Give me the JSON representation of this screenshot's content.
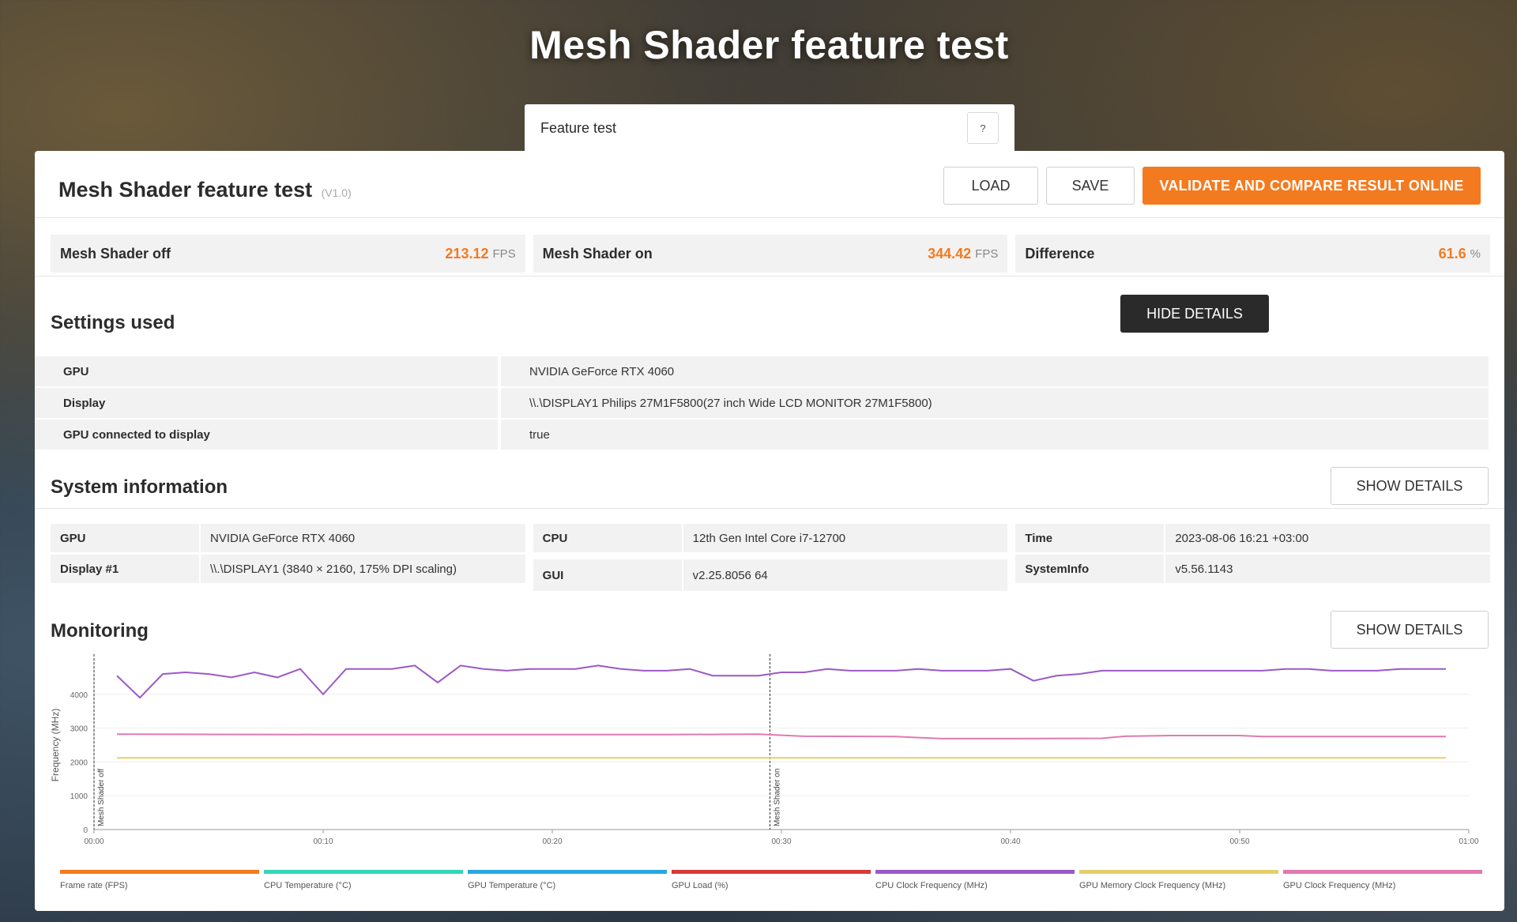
{
  "hero_title": "Mesh Shader feature test",
  "tab_selector": {
    "label": "Feature test",
    "help": "?"
  },
  "panel": {
    "title": "Mesh Shader feature test",
    "version": "(V1.0)",
    "load_label": "LOAD",
    "save_label": "SAVE",
    "validate_label": "VALIDATE AND COMPARE RESULT ONLINE"
  },
  "scores": [
    {
      "label": "Mesh Shader off",
      "value": "213.12",
      "unit": "FPS"
    },
    {
      "label": "Mesh Shader on",
      "value": "344.42",
      "unit": "FPS"
    },
    {
      "label": "Difference",
      "value": "61.6",
      "unit": "%"
    }
  ],
  "settings": {
    "title": "Settings used",
    "button": "HIDE DETAILS",
    "rows": [
      {
        "key": "GPU",
        "value": "NVIDIA GeForce RTX 4060"
      },
      {
        "key": "Display",
        "value": "\\\\.\\DISPLAY1 Philips 27M1F5800(27 inch Wide LCD MONITOR 27M1F5800)"
      },
      {
        "key": "GPU connected to display",
        "value": "true"
      }
    ]
  },
  "system": {
    "title": "System information",
    "button": "SHOW DETAILS",
    "columns": [
      [
        {
          "key": "GPU",
          "value": "NVIDIA GeForce RTX 4060"
        },
        {
          "key": "Display #1",
          "value": "\\\\.\\DISPLAY1 (3840 × 2160, 175% DPI scaling)"
        }
      ],
      [
        {
          "key": "CPU",
          "value": "12th Gen Intel Core i7-12700"
        },
        {
          "key": "GUI",
          "value": "v2.25.8056 64"
        }
      ],
      [
        {
          "key": "Time",
          "value": "2023-08-06 16:21 +03:00"
        },
        {
          "key": "SystemInfo",
          "value": "v5.56.1143"
        }
      ]
    ]
  },
  "monitoring": {
    "title": "Monitoring",
    "button": "SHOW DETAILS"
  },
  "chart_data": {
    "type": "line",
    "ylabel": "Frequency (MHz)",
    "ylim": [
      0,
      5000
    ],
    "yticks": [
      0,
      1000,
      2000,
      3000,
      4000
    ],
    "xticks": [
      "00:00",
      "00:10",
      "00:20",
      "00:30",
      "00:40",
      "00:50",
      "01:00"
    ],
    "xlim": [
      0,
      60
    ],
    "markers": [
      {
        "label": "Mesh Shader off",
        "x": 0
      },
      {
        "label": "Mesh Shader on",
        "x": 29.5
      }
    ],
    "series": [
      {
        "name": "CPU Clock Frequency (MHz)",
        "color": "#9b59c6",
        "x": [
          1,
          2,
          3,
          4,
          5,
          6,
          7,
          8,
          9,
          10,
          11,
          12,
          13,
          14,
          15,
          16,
          17,
          18,
          19,
          20,
          21,
          22,
          23,
          24,
          25,
          26,
          27,
          28,
          29,
          30,
          31,
          32,
          33,
          34,
          35,
          36,
          37,
          38,
          39,
          40,
          41,
          42,
          43,
          44,
          45,
          46,
          47,
          48,
          49,
          50,
          51,
          52,
          53,
          54,
          55,
          56,
          57,
          58,
          59
        ],
        "values": [
          4550,
          3900,
          4600,
          4650,
          4600,
          4500,
          4650,
          4500,
          4750,
          4000,
          4750,
          4750,
          4750,
          4850,
          4350,
          4850,
          4750,
          4700,
          4750,
          4750,
          4750,
          4850,
          4750,
          4700,
          4700,
          4750,
          4550,
          4550,
          4550,
          4650,
          4650,
          4750,
          4700,
          4700,
          4700,
          4750,
          4700,
          4700,
          4700,
          4750,
          4400,
          4550,
          4600,
          4700,
          4700,
          4700,
          4700,
          4700,
          4700,
          4700,
          4700,
          4750,
          4750,
          4700,
          4700,
          4700,
          4750,
          4750,
          4750
        ]
      },
      {
        "name": "GPU Clock Frequency (MHz)",
        "color": "#e07ab0",
        "x": [
          1,
          10,
          20,
          25,
          29,
          30,
          31,
          35,
          37,
          40,
          44,
          45,
          47,
          50,
          51,
          55,
          59
        ],
        "values": [
          2820,
          2810,
          2810,
          2810,
          2820,
          2790,
          2760,
          2750,
          2690,
          2690,
          2700,
          2760,
          2780,
          2780,
          2750,
          2750,
          2750
        ]
      },
      {
        "name": "GPU Memory Clock Frequency (MHz)",
        "color": "#e3cf6a",
        "x": [
          1,
          59
        ],
        "values": [
          2120,
          2120
        ]
      }
    ],
    "legend": [
      {
        "name": "Frame rate (FPS)",
        "color": "#f47a1f"
      },
      {
        "name": "CPU Temperature (°C)",
        "color": "#34d6b8"
      },
      {
        "name": "GPU Temperature (°C)",
        "color": "#2aa7e0"
      },
      {
        "name": "GPU Load (%)",
        "color": "#d63a3a"
      },
      {
        "name": "CPU Clock Frequency (MHz)",
        "color": "#9b59c6"
      },
      {
        "name": "GPU Memory Clock Frequency (MHz)",
        "color": "#e3cf6a"
      },
      {
        "name": "GPU Clock Frequency (MHz)",
        "color": "#e07ab0"
      }
    ]
  }
}
